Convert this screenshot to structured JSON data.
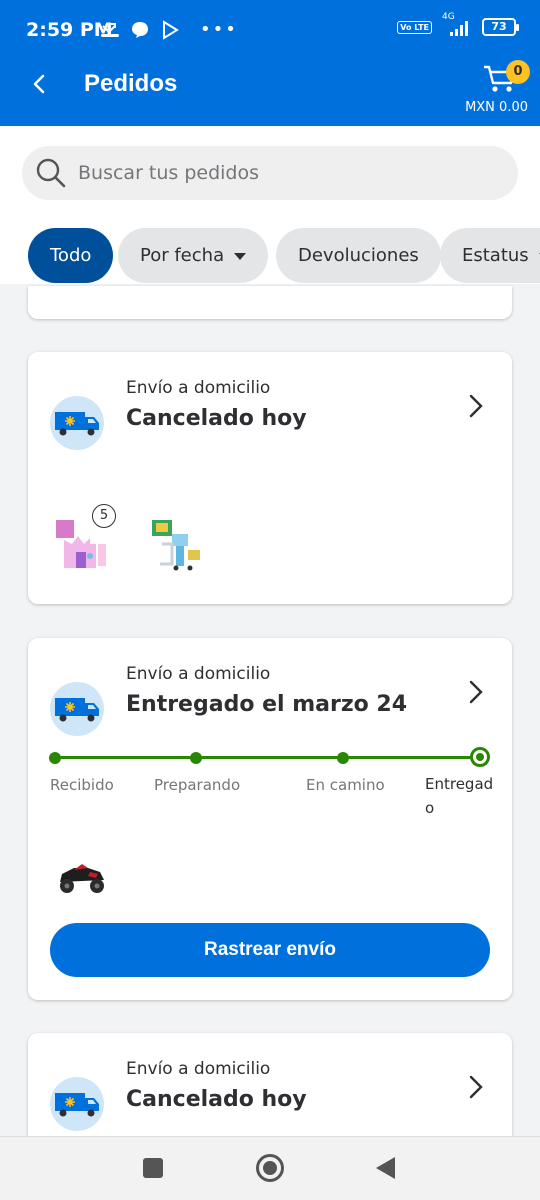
{
  "status_bar": {
    "time": "2:59 PM",
    "network": "4G",
    "volte": "Vo LTE",
    "battery": "73"
  },
  "header": {
    "title": "Pedidos",
    "cart_count": "0",
    "cart_amount": "MXN 0.00",
    "accent_color": "#0071dc"
  },
  "search": {
    "placeholder": "Buscar tus pedidos",
    "value": ""
  },
  "filters": [
    {
      "label": "Todo",
      "selected": true
    },
    {
      "label": "Por fecha",
      "dropdown": true
    },
    {
      "label": "Devoluciones"
    },
    {
      "label": "Estatus",
      "dropdown": true
    }
  ],
  "orders": [
    {
      "type": "Envío a domicilio",
      "status": "Cancelado hoy",
      "items": [
        {
          "icon": "toy-castle-image",
          "quantity": "5"
        },
        {
          "icon": "toy-playset-image"
        }
      ]
    },
    {
      "type": "Envío a domicilio",
      "status": "Entregado el marzo 24",
      "tracking_steps": [
        "Recibido",
        "Preparando",
        "En camino",
        "Entregado"
      ],
      "current_step": 4,
      "items": [
        {
          "icon": "ride-on-atv-image"
        }
      ],
      "button": "Rastrear envío",
      "progress_color": "#2a8703"
    },
    {
      "type": "Envío a domicilio",
      "status": "Cancelado hoy"
    }
  ]
}
